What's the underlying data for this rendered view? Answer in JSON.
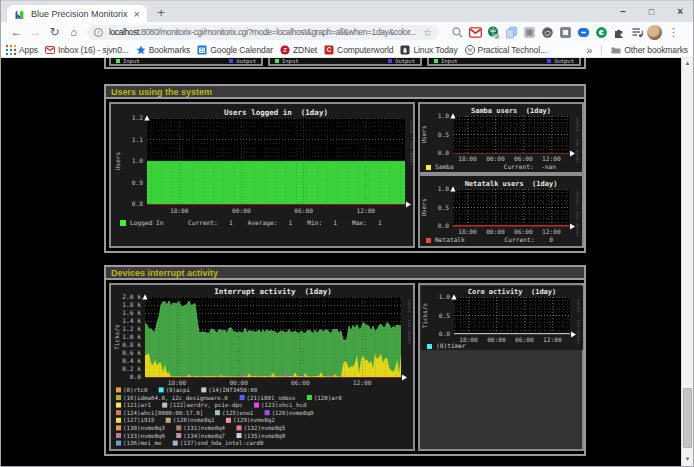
{
  "browser": {
    "tab_title": "Blue Precision Monitorix",
    "glyphs": {
      "close": "×",
      "plus": "+",
      "minimize": "–",
      "maximize": "□",
      "back": "←",
      "forward": "→",
      "reload": "↻",
      "home": "⌂",
      "info": "i",
      "star": "☆",
      "menu": "⋮",
      "overflow": "»",
      "arrow_up": "▲",
      "arrow_down": "▼"
    },
    "url": {
      "host": "localhost",
      "rest": ":8080/monitorix-cgi/monitorix.cgi?mode=localhost&graph=all&when=1day&color..."
    },
    "extensions": [
      {
        "icon": "magnifier-icon"
      },
      {
        "icon": "gmail-icon"
      },
      {
        "icon": "green-globe-icon"
      },
      {
        "icon": "copy-pages-icon"
      },
      {
        "icon": "grey-box-icon"
      },
      {
        "icon": "dark-swirl-icon"
      },
      {
        "icon": "frame-icon"
      },
      {
        "icon": "blue-oval-icon"
      },
      {
        "icon": "green-circle-icon"
      },
      {
        "icon": "puzzle-icon"
      },
      {
        "icon": "playlist-icon"
      }
    ],
    "bookmarks": [
      {
        "icon": "apps-grid-icon",
        "label": "Apps"
      },
      {
        "icon": "gmail-icon",
        "label": "Inbox (16) - sjvn0..."
      },
      {
        "icon": "star-blue-icon",
        "label": "Bookmarks"
      },
      {
        "icon": "calendar-icon",
        "label": "Google Calendar"
      },
      {
        "icon": "zdnet-icon",
        "label": "ZDNet"
      },
      {
        "icon": "computerworld-icon",
        "label": "Computerworld"
      },
      {
        "icon": "linux-today-icon",
        "label": "Linux Today"
      },
      {
        "icon": "wordpress-icon",
        "label": "Practical Technol..."
      }
    ],
    "other_bookmarks": {
      "icon": "folder-icon",
      "label": "Other bookmarks"
    }
  },
  "page": {
    "cutoff_panels": [
      {
        "left": {
          "color": "#44EE44",
          "label": "Input"
        },
        "right": {
          "color": "#4444EE",
          "label": "Output"
        }
      },
      {
        "left": {
          "color": "#44EE44",
          "label": "Input"
        },
        "right": {
          "color": "#4444EE",
          "label": "Output"
        }
      },
      {
        "left": {
          "color": "#44EE44",
          "label": "Input"
        },
        "right": {
          "color": "#4444EE",
          "label": "Output"
        }
      }
    ],
    "sections": [
      {
        "id": "users",
        "title": "Users using the system"
      },
      {
        "id": "interrupts",
        "title": "Devices interrupt activity"
      }
    ]
  },
  "graphs": {
    "users": {
      "title": "Users logged in  (1day)",
      "ylabel": "Users",
      "yticks": [
        "1.2",
        "1.1",
        "1.0",
        "0.9",
        "0.8"
      ],
      "xticks": [
        "18:00",
        "00:00",
        "06:00",
        "12:00"
      ],
      "watermark": "RRDTOOL / TOBI OETIKER",
      "flat_area": {
        "value": 1.0,
        "ymin": 0.8,
        "ymax": 1.2,
        "fill": "#3BD23B",
        "line": "#00EE00"
      },
      "legend": [
        {
          "color": "#44EE44",
          "label": "Logged In"
        }
      ],
      "stats": "Current:   1    Average:   1    Min:   1    Max:   1"
    },
    "samba": {
      "title": "Samba users  (1day)",
      "ylabel": "Users",
      "yticks": [
        "1.0",
        "0.5",
        "0.0"
      ],
      "xticks": [
        "18:00",
        "00:00",
        "06:00",
        "12:00"
      ],
      "watermark": "RRDTOOL / TOBI OETIKER",
      "legend": [
        {
          "color": "#EEEE44",
          "label": "Samba"
        }
      ],
      "stats": "Current:  -nan"
    },
    "netatalk": {
      "title": "Netatalk users  (1day)",
      "ylabel": "Users",
      "yticks": [
        "1.0",
        "0.5",
        "0.0"
      ],
      "xticks": [
        "18:00",
        "00:00",
        "06:00",
        "12:00"
      ],
      "watermark": "RRDTOOL / TOBI OETIKER",
      "zero_line": "#CC2222",
      "legend": [
        {
          "color": "#EE4444",
          "label": "Netatalk"
        }
      ],
      "stats": "Current:    0"
    },
    "core": {
      "title": "Core activity  (1day)",
      "ylabel": "Ticks/s",
      "yticks": [
        "1.0",
        "0.5",
        "0.0"
      ],
      "xticks": [
        "18:00",
        "00:00",
        "06:00",
        "12:00"
      ],
      "watermark": "RRDTOOL / TOBI OETIKER",
      "zero_line": "#44EEEE",
      "legend": [
        {
          "color": "#44EEEE",
          "label": "(0)timer"
        }
      ],
      "stats": ""
    },
    "interrupt": {
      "title": "Interrupt activity  (1day)",
      "ylabel": "Ticks/s",
      "yticks": [
        "2.0 k",
        "1.8 k",
        "1.6 k",
        "1.4 k",
        "1.2 k",
        "1.0 k",
        "0.8 k",
        "0.6 k",
        "0.4 k",
        "0.2 k",
        "0.0"
      ],
      "xticks": [
        "18:00",
        "00:00",
        "06:00",
        "12:00"
      ],
      "watermark": "RRDTOOL / TOBI OETIKER",
      "ymax": 2.0,
      "series": {
        "green": {
          "fill": "#44A344",
          "line": "#54BE54",
          "values": [
            1.36,
            1.3,
            1.19,
            1.21,
            1.14,
            1.12,
            1.36,
            1.51,
            1.79,
            1.88,
            1.88,
            1.8,
            1.9,
            1.76,
            1.85,
            1.84,
            1.84,
            1.89,
            1.76,
            1.76,
            1.79,
            1.81,
            1.9,
            1.78,
            1.81,
            1.84,
            1.46,
            1.11,
            1.11,
            1.13,
            1.11,
            1.1,
            1.09,
            1.2,
            1.19,
            1.15,
            1.09,
            1.18,
            1.18,
            1.15,
            1.17,
            1.08,
            1.22,
            1.23,
            1.13,
            1.13,
            1.1,
            1.13,
            1.12,
            1.09,
            1.23,
            1.09,
            1.17,
            1.13,
            1.15,
            1.12,
            1.13,
            1.18,
            1.09,
            1.18,
            1.1,
            1.19,
            1.13,
            1.16,
            1.14,
            1.14,
            1.09,
            1.11,
            1.15,
            1.14,
            1.11,
            1.11,
            1.19,
            1.11,
            1.12,
            1.15,
            1.11,
            1.09,
            1.15,
            1.11,
            1.09,
            1.15,
            1.17,
            1.14,
            1.09,
            1.17,
            1.09,
            1.15,
            1.19,
            1.12,
            1.17,
            1.18,
            1.13,
            1.08,
            1.19,
            1.19,
            1.19,
            1.09,
            1.15,
            0.93,
            0.91,
            0.96,
            1.27,
            1.15,
            1.29,
            1.21,
            1.31,
            1.19,
            1.22,
            1.36,
            1.32,
            1.29,
            1.27,
            1.15,
            1.27,
            1.14,
            1.17,
            1.29,
            1.32,
            1.25,
            1.24,
            1.36,
            1.32,
            1.2,
            1.26,
            1.24,
            1.3,
            1.28,
            1.28
          ]
        },
        "yellow": {
          "fill": "#E0D71A",
          "values": [
            0.53,
            0.57,
            0.59,
            0.35,
            0.3,
            0.43,
            0.29,
            0.37,
            0.35,
            0.12,
            0.32,
            0.1,
            0.12,
            0.016,
            0.014,
            0.02,
            0.013,
            0.018,
            0.016,
            0.013,
            0.018,
            0.012,
            0.07,
            0.013,
            0.013,
            0.017,
            0.022,
            0.013,
            0.015,
            0.02,
            0.023,
            0.019,
            0.017,
            0.024,
            0.013,
            0.022,
            0.015,
            0.014,
            0.06,
            0.016,
            0.022,
            0.014,
            0.019,
            0.02,
            0.016,
            0.019,
            0.013,
            0.013,
            0.014,
            0.02,
            0.017,
            0.016,
            0.09,
            0.017,
            0.016,
            0.022,
            0.02,
            0.015,
            0.019,
            0.018,
            0.023,
            0.021,
            0.015,
            0.024,
            0.11,
            0.017,
            0.021,
            0.014,
            0.018,
            0.012,
            0.02,
            0.021,
            0.019,
            0.023,
            0.016,
            0.12,
            0.019,
            0.019,
            0.017,
            0.022,
            0.1,
            0.018,
            0.02,
            0.013,
            0.02,
            0.02,
            0.024,
            0.022,
            0.13,
            0.017,
            0.02,
            0.012,
            0.018,
            0.014,
            0.013,
            0.07,
            0.021,
            0.014,
            0.015,
            0.33,
            0.41,
            0.34,
            0.22,
            0.27,
            0.25,
            0.36,
            0.55,
            0.1,
            0.43,
            0.55,
            0.42,
            0.44,
            0.34,
            0.41,
            0.22,
            0.6,
            0.45,
            0.5,
            0.58,
            0.35,
            0.47,
            0.48,
            0.24,
            0.17,
            0.13,
            0.2,
            0.45,
            0.1,
            0.58
          ]
        },
        "purple": {
          "color": "#B066CC",
          "spikes": [
            [
              0.38,
              0.1
            ],
            [
              0.55,
              0.12
            ],
            [
              0.62,
              0.08
            ]
          ]
        }
      },
      "legend_rows": [
        [
          {
            "color": "#E8A33D",
            "label": "(8)rtc0"
          },
          {
            "color": "#44EEEE",
            "label": "(9)acpi"
          },
          {
            "color": "#CCCCCC",
            "label": "(14)INT3450:00"
          }
        ],
        [
          {
            "color": "#B8A93C",
            "label": "(16)idma64.0, i2c_designware.0"
          },
          {
            "color": "#5B5BEE",
            "label": "(21)i801_smbus"
          },
          {
            "color": "#44DD44",
            "label": "(120)ar0"
          }
        ],
        [
          {
            "color": "#EEEE44",
            "label": "(121)ar1"
          },
          {
            "color": "#C0C0C0",
            "label": "(122)aerdrv, pcie-dpc"
          },
          {
            "color": "#EE44EE",
            "label": "(123)xhci_hcd"
          }
        ],
        [
          {
            "color": "#CC7A66",
            "label": "(124)ahci[0000:00:17.0]"
          },
          {
            "color": "#A8C0A8",
            "label": "(125)eno1"
          },
          {
            "color": "#9955EE",
            "label": "(126)nvme0q0"
          }
        ],
        [
          {
            "color": "#E7E73C",
            "label": "(127)i915"
          },
          {
            "color": "#C8A878",
            "label": "(128)nvme0q1"
          },
          {
            "color": "#E89C9C",
            "label": "(129)nvme0q2"
          }
        ],
        [
          {
            "color": "#EE9944",
            "label": "(130)nvme0q3"
          },
          {
            "color": "#A08870",
            "label": "(131)nvme0q4"
          },
          {
            "color": "#EE7788",
            "label": "(132)nvme0q5"
          }
        ],
        [
          {
            "color": "#BB7A99",
            "label": "(133)nvme0q6"
          },
          {
            "color": "#CC8FA0",
            "label": "(134)nvme0q7"
          },
          {
            "color": "#C9CCDD",
            "label": "(135)nvme0q8"
          }
        ],
        [
          {
            "color": "#7799CC",
            "label": "(136)mei_me"
          },
          {
            "color": "#9FB6D9",
            "label": "(137)snd_hda_intel:card0"
          }
        ]
      ]
    }
  }
}
